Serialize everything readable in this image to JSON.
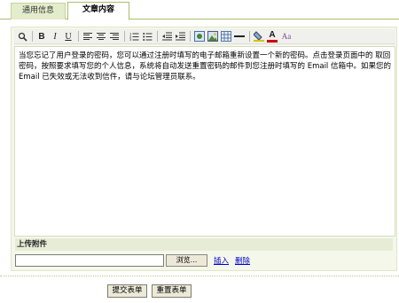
{
  "tabs": [
    {
      "label": "通用信息"
    },
    {
      "label": "文章内容"
    }
  ],
  "editor": {
    "content": "当您忘记了用户登录的密码，您可以通过注册时填写的电子邮箱重新设置一个新的密码。点击登录页面中的 取回密码，按照要求填写您的个人信息，系统将自动发送重置密码的邮件到您注册时填写的 Email 信箱中。如果您的 Email 已失效或无法收到信件，请与论坛管理员联系。"
  },
  "toolbar": {
    "bold": "B",
    "italic": "I",
    "underline": "U",
    "font_color": "A",
    "font_size": "Aa",
    "colors": {
      "font_color": "#cc0000",
      "highlight": "#d4c400"
    }
  },
  "attachment": {
    "label": "上传附件",
    "browse": "浏览...",
    "insert": "插入",
    "delete": "删除"
  },
  "buttons": {
    "submit": "提交表单",
    "reset": "重置表单"
  }
}
